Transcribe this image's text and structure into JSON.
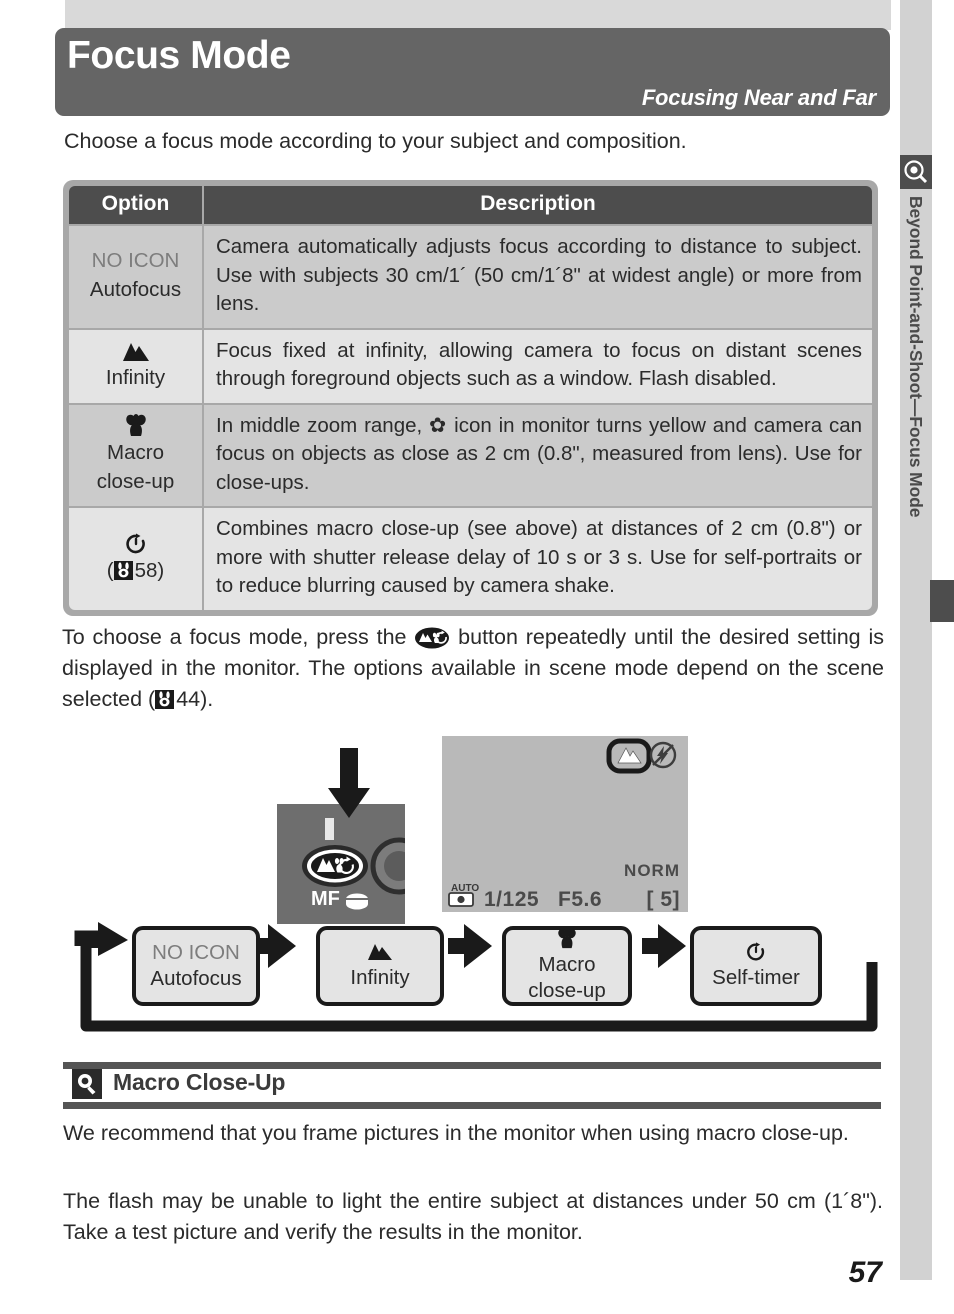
{
  "header": {
    "title": "Focus Mode",
    "subtitle": "Focusing Near and Far"
  },
  "intro": "Choose a focus mode according to your subject and composition.",
  "table": {
    "columns": [
      "Option",
      "Description"
    ],
    "rows": [
      {
        "icon": "no-icon-text",
        "icon_label": "NO ICON",
        "option": "Autofocus",
        "description": "Camera automatically adjusts focus according to distance to subject.  Use with subjects 30 cm/1´ (50 cm/1´8ʺ at widest angle) or more from lens."
      },
      {
        "icon": "mountain-infinity-icon",
        "option": "Infinity",
        "description": "Focus fixed at infinity, allowing camera to focus on distant scenes through foreground objects such as a window.  Flash disabled."
      },
      {
        "icon": "flower-macro-icon",
        "option": "Macro",
        "option2": "close-up",
        "description": "In middle zoom range, ✿ icon in monitor turns yellow and camera can focus on objects as close as 2 cm (0.8ʺ, measured from lens).  Use for close-ups."
      },
      {
        "icon": "self-timer-icon",
        "option": "Self-timer",
        "reference": "58",
        "description": "Combines macro close-up (see above) at distances of 2 cm (0.8ʺ) or more with shutter release delay of 10 s or 3 s.  Use for self-portraits or to reduce blurring caused by camera shake."
      }
    ]
  },
  "body_paragraph": {
    "part1": "To choose a focus mode, press the",
    "part2": "button repeatedly until the desired setting is displayed in the monitor.  The options available in scene mode depend on the scene selected (",
    "reference": "44",
    "part3": ").",
    "button_icon": "focus-mode-button-icon"
  },
  "illustration": {
    "camera_label": "MF",
    "monitor": {
      "mode_icon": "auto-camera-icon",
      "shutter_speed": "1/125",
      "aperture": "F5.6",
      "frames_remaining": "[     5]",
      "quality": "NORM",
      "selected_icon": "mountain-infinity-icon",
      "flash_icon": "flash-off-icon"
    }
  },
  "flow": {
    "steps": [
      {
        "icon": "no-icon-text",
        "icon_label": "NO ICON",
        "label": "Autofocus",
        "label2": ""
      },
      {
        "icon": "mountain-infinity-icon",
        "label": "Infinity",
        "label2": ""
      },
      {
        "icon": "flower-macro-icon",
        "label": "Macro",
        "label2": "close-up"
      },
      {
        "icon": "self-timer-icon",
        "label": "Self-timer",
        "label2": ""
      }
    ]
  },
  "tip": {
    "icon": "tip-lightbulb-icon",
    "title": "Macro Close-Up",
    "paragraph1": "We recommend that you frame pictures in the monitor when using macro close-up.",
    "paragraph2": "The flash may be unable to light the entire subject at distances under 50 cm (1´8ʺ).  Take a test picture and verify the results in the monitor."
  },
  "sidebar": {
    "icon": "magnifier-camera-icon",
    "text": "Beyond Point-and-Shoot—Focus Mode"
  },
  "page_number": "57",
  "colors": {
    "banner": "#656565",
    "header_row": "#4d4d4d",
    "row_shade_dark": "#cbcbcb",
    "row_shade_light": "#e4e4e4",
    "table_border": "#a8a8a8",
    "sidebar": "#d2d2d2"
  }
}
